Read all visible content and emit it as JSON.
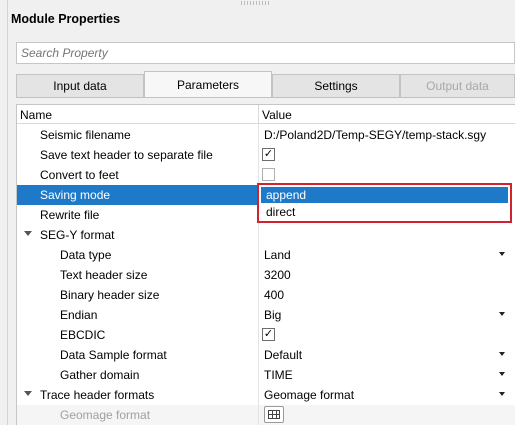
{
  "panel": {
    "title": "Module Properties"
  },
  "search": {
    "placeholder": "Search Property"
  },
  "tabs": [
    {
      "label": "Input data",
      "state": "normal"
    },
    {
      "label": "Parameters",
      "state": "active"
    },
    {
      "label": "Settings",
      "state": "normal"
    },
    {
      "label": "Output data",
      "state": "disabled"
    }
  ],
  "grid": {
    "columns": {
      "name": "Name",
      "value": "Value"
    },
    "rows": {
      "seismic_filename": {
        "label": "Seismic filename",
        "value": "D:/Poland2D/Temp-SEGY/temp-stack.sgy"
      },
      "save_text_header": {
        "label": "Save text header to separate file",
        "checked": true
      },
      "convert_to_feet": {
        "label": "Convert to feet",
        "checked": false
      },
      "saving_mode": {
        "label": "Saving mode"
      },
      "rewrite_file": {
        "label": "Rewrite file"
      },
      "segy_format": {
        "label": "SEG-Y format"
      },
      "data_type": {
        "label": "Data type",
        "value": "Land"
      },
      "text_header_size": {
        "label": "Text header size",
        "value": "3200"
      },
      "binary_header_size": {
        "label": "Binary header size",
        "value": "400"
      },
      "endian": {
        "label": "Endian",
        "value": "Big"
      },
      "ebcdic": {
        "label": "EBCDIC",
        "checked": true
      },
      "data_sample_format": {
        "label": "Data Sample format",
        "value": "Default"
      },
      "gather_domain": {
        "label": "Gather domain",
        "value": "TIME"
      },
      "trace_header_formats": {
        "label": "Trace header formats",
        "value": "Geomage format"
      },
      "geomage_format": {
        "label": "Geomage format"
      }
    }
  },
  "saving_mode_dropdown": {
    "options": [
      "append",
      "direct"
    ],
    "selected": "append"
  },
  "colors": {
    "selection": "#1e7ac9",
    "highlight_border": "#d0222f"
  },
  "icons": {
    "check": "✓",
    "table": "table-grid-icon"
  }
}
